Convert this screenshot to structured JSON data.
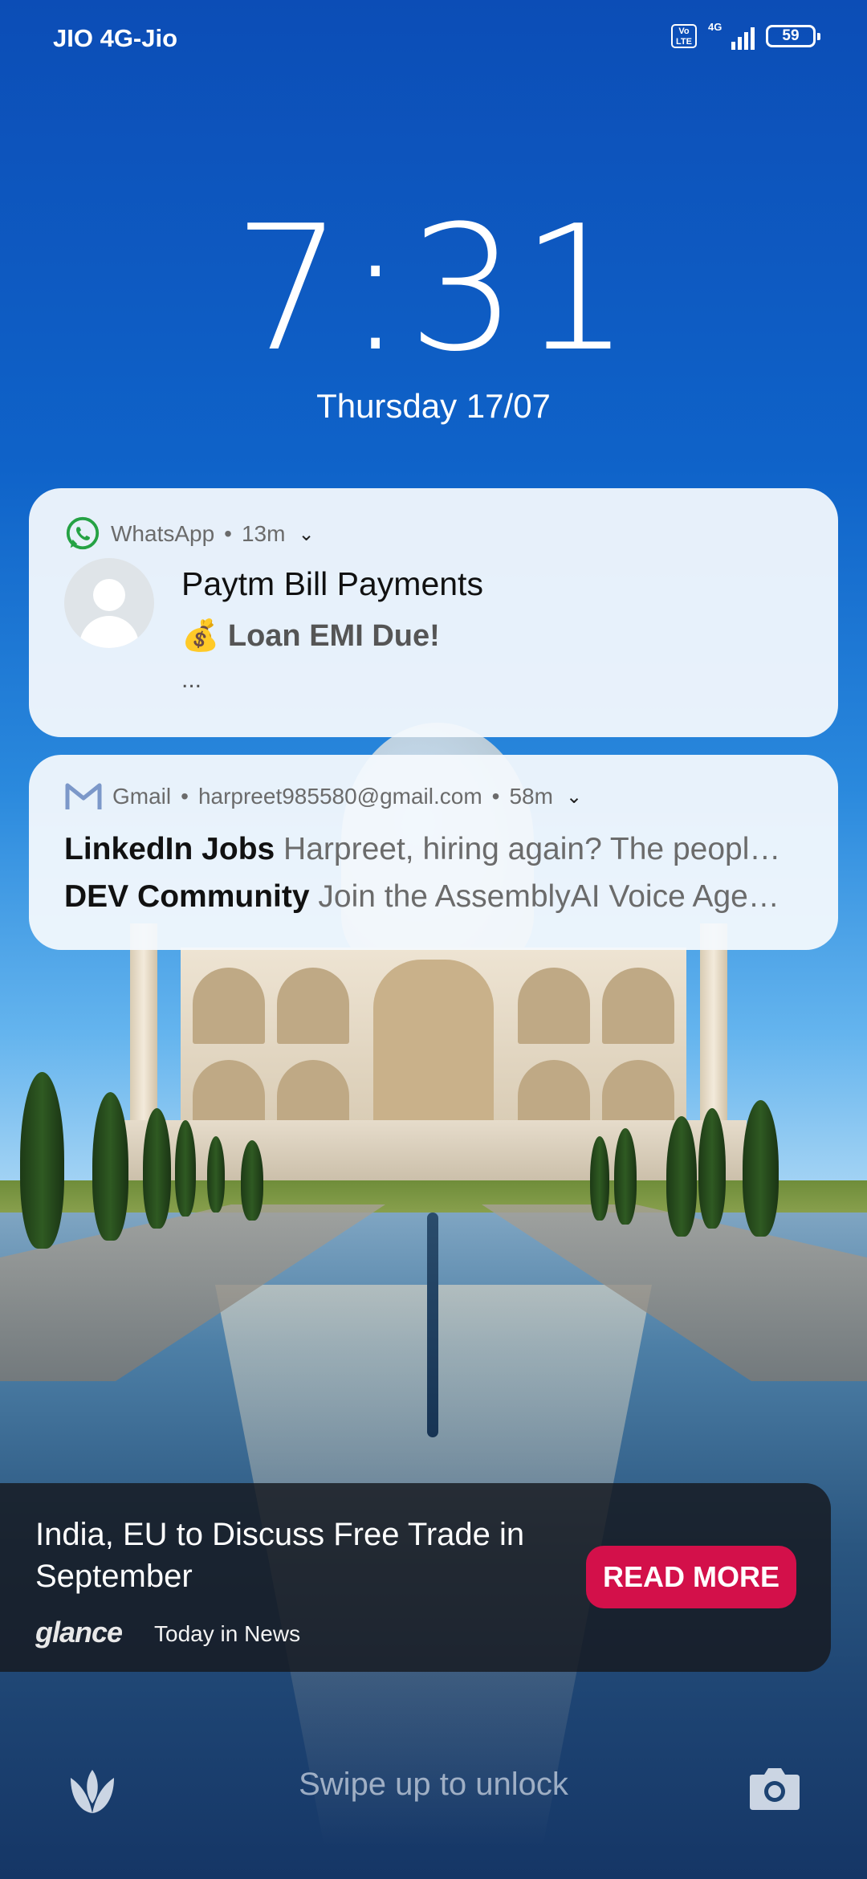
{
  "status_bar": {
    "carrier": "JIO 4G-Jio",
    "volte_badge": "Vo LTE",
    "network_type": "4G",
    "signal_level": 4,
    "battery_level": "59"
  },
  "lock_screen": {
    "time": "7:31",
    "date": "Thursday 17/07"
  },
  "notifications": [
    {
      "app": "WhatsApp",
      "age": "13m",
      "title": "Paytm Bill Payments",
      "body": "💰 Loan EMI Due!",
      "more": "...",
      "icon": "whatsapp-icon",
      "accent": "#25a244"
    },
    {
      "app": "Gmail",
      "account": "harpreet985580@gmail.com",
      "age": "58m",
      "icon": "gmail-icon",
      "accent": "#7c98c9",
      "messages": [
        {
          "sender": "LinkedIn Jobs",
          "subject": "Harpreet, hiring again? The peopl…"
        },
        {
          "sender": "DEV Community",
          "subject": "Join the AssemblyAI Voice Age…"
        }
      ]
    }
  ],
  "news": {
    "headline": "India, EU to Discuss Free Trade in September",
    "brand": "glance",
    "source": "Today in News",
    "button": "READ MORE",
    "button_color": "#d3104a"
  },
  "bottom_bar": {
    "swipe_hint": "Swipe up to unlock",
    "left_icon": "glance-tulip-icon",
    "right_icon": "camera-icon"
  },
  "separator": "•"
}
